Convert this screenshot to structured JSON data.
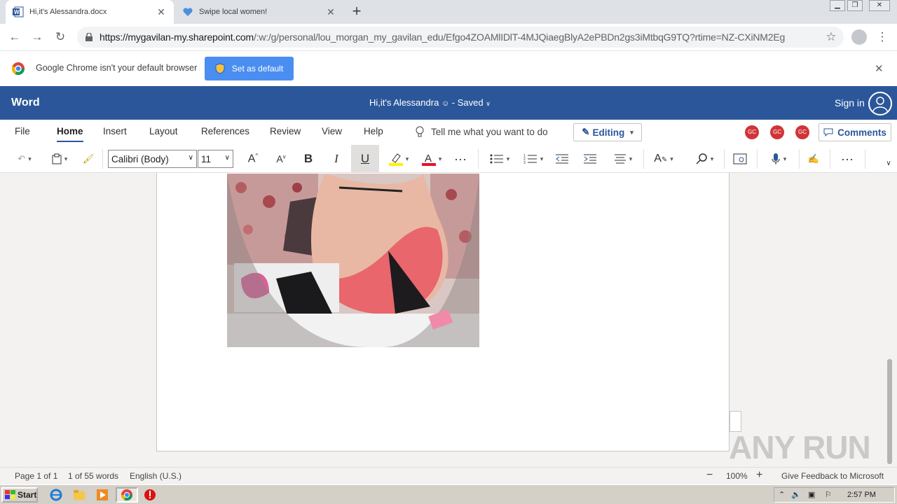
{
  "browser": {
    "tabs": [
      {
        "title": "Hi,it's Alessandra.docx",
        "active": true
      },
      {
        "title": "Swipe local women!",
        "active": false
      }
    ],
    "url_host": "https://mygavilan-my.sharepoint.com",
    "url_path": "/:w:/g/personal/lou_morgan_my_gavilan_edu/Efgo4ZOAMlIDlT-4MJQiaegBlyA2ePBDn2gs3iMtbqG9TQ?rtime=NZ-CXiNM2Eg",
    "infobar_text": "Google Chrome isn't your default browser",
    "set_default_label": "Set as default"
  },
  "word": {
    "app_name": "Word",
    "doc_title": "Hi,it's Alessandra",
    "saved_label": "Saved",
    "sign_in": "Sign in",
    "ribbon_tabs": [
      "File",
      "Home",
      "Insert",
      "Layout",
      "References",
      "Review",
      "View",
      "Help"
    ],
    "tell_me": "Tell me what you want to do",
    "editing_label": "Editing",
    "collaborators": [
      "GC",
      "GC",
      "GC"
    ],
    "comments_label": "Comments",
    "font_name": "Calibri (Body)",
    "font_size": "11"
  },
  "status": {
    "page": "Page 1 of 1",
    "words": "1 of 55 words",
    "language": "English (U.S.)",
    "zoom": "100%",
    "feedback": "Give Feedback to Microsoft"
  },
  "taskbar": {
    "start": "Start",
    "clock": "2:57 PM"
  },
  "watermark": "ANY RUN",
  "colors": {
    "word_blue": "#2b579a",
    "chrome_button": "#4b8ef1",
    "collab_red": "#d13438"
  }
}
